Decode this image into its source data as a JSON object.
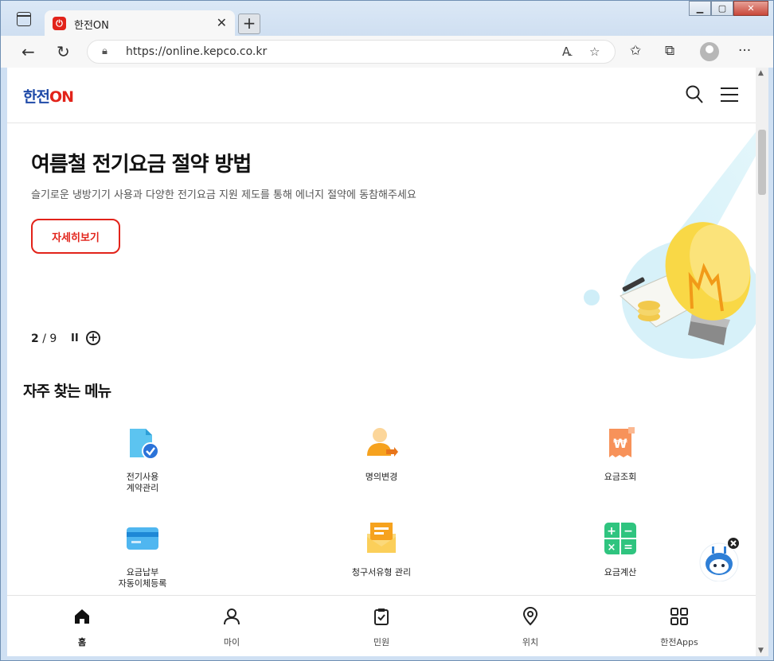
{
  "browser": {
    "tab_title": "한전ON",
    "tab_favicon": "⏻",
    "url": "https://online.kepco.co.kr",
    "icons": [
      "tab-actions-icon",
      "close-icon",
      "new-tab-icon",
      "back-icon",
      "refresh-icon",
      "lock-icon",
      "read-aloud-icon",
      "favorite-add-icon",
      "favorites-icon",
      "collections-icon",
      "profile-icon",
      "more-icon"
    ]
  },
  "site": {
    "logo_part1": "한전",
    "logo_part2": "ON",
    "brand_red": "#e2231a",
    "brand_blue": "#1f4aa8"
  },
  "banner": {
    "title": "여름철 전기요금 절약 방법",
    "subtitle": "슬기로운 냉방기기 사용과 다양한 전기요금 지원 제도를 통해 에너지 절약에 동참해주세요",
    "button": "자세히보기",
    "page_current": "2",
    "page_sep": "/",
    "page_total": "9",
    "pause": "II",
    "plus": "+"
  },
  "menu": {
    "title": "자주 찾는 메뉴",
    "items": [
      {
        "label": "전기사용\n계약관리",
        "icon": "contract-icon"
      },
      {
        "label": "명의변경",
        "icon": "name-change-icon"
      },
      {
        "label": "요금조회",
        "icon": "bill-inquiry-icon"
      },
      {
        "label": "요금납부\n자동이체등록",
        "icon": "card-icon"
      },
      {
        "label": "청구서유형 관리",
        "icon": "bill-envelope-icon"
      },
      {
        "label": "요금계산",
        "icon": "calculator-icon"
      }
    ]
  },
  "bottom_nav": [
    {
      "label": "홈",
      "icon": "home-icon"
    },
    {
      "label": "마이",
      "icon": "person-icon"
    },
    {
      "label": "민원",
      "icon": "clipboard-icon"
    },
    {
      "label": "위치",
      "icon": "location-icon"
    },
    {
      "label": "한전Apps",
      "icon": "apps-grid-icon"
    }
  ]
}
